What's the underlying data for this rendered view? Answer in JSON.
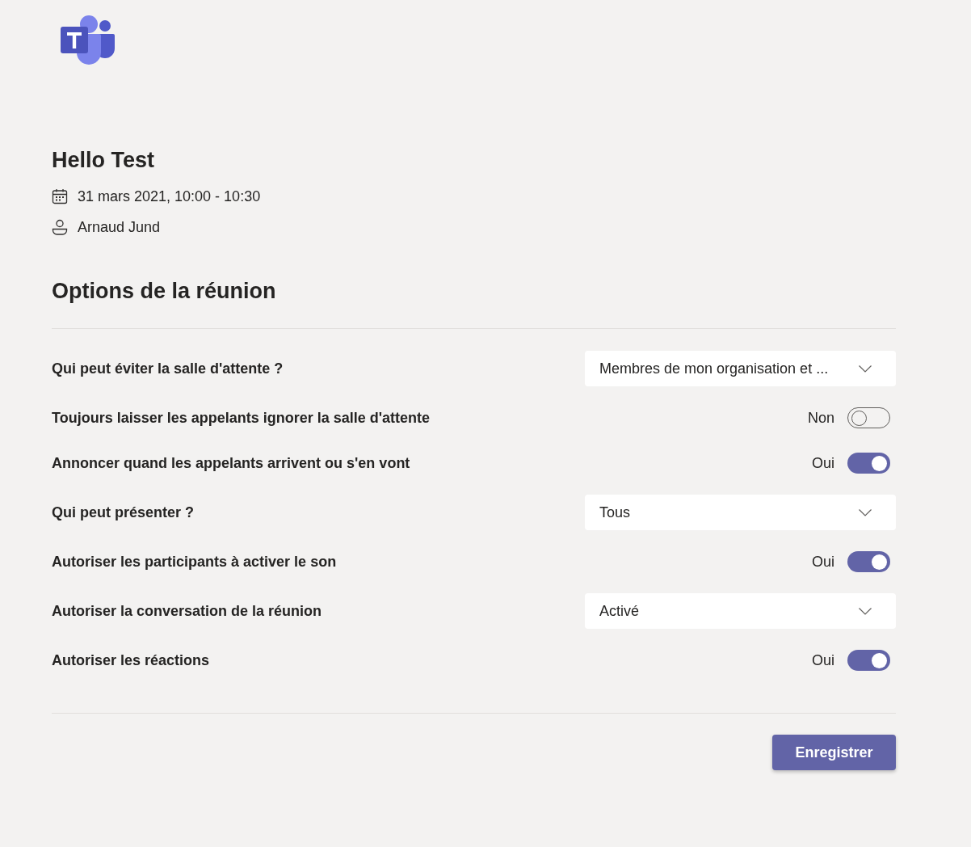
{
  "meeting": {
    "title": "Hello Test",
    "datetime": "31 mars 2021, 10:00 - 10:30",
    "organizer": "Arnaud Jund"
  },
  "options": {
    "title": "Options de la réunion",
    "rows": [
      {
        "kind": "dropdown",
        "label": "Qui peut éviter la salle d'attente ?",
        "value": "Membres de mon organisation et ..."
      },
      {
        "kind": "toggle",
        "label": "Toujours laisser les appelants ignorer la salle d'attente",
        "on": false,
        "state_label": "Non"
      },
      {
        "kind": "toggle",
        "label": "Annoncer quand les appelants arrivent ou s'en vont",
        "on": true,
        "state_label": "Oui"
      },
      {
        "kind": "dropdown",
        "label": "Qui peut présenter ?",
        "value": "Tous"
      },
      {
        "kind": "toggle",
        "label": "Autoriser les participants à activer le son",
        "on": true,
        "state_label": "Oui"
      },
      {
        "kind": "dropdown",
        "label": "Autoriser la conversation de la réunion",
        "value": "Activé"
      },
      {
        "kind": "toggle",
        "label": "Autoriser les réactions",
        "on": true,
        "state_label": "Oui"
      }
    ]
  },
  "save_button": "Enregistrer"
}
